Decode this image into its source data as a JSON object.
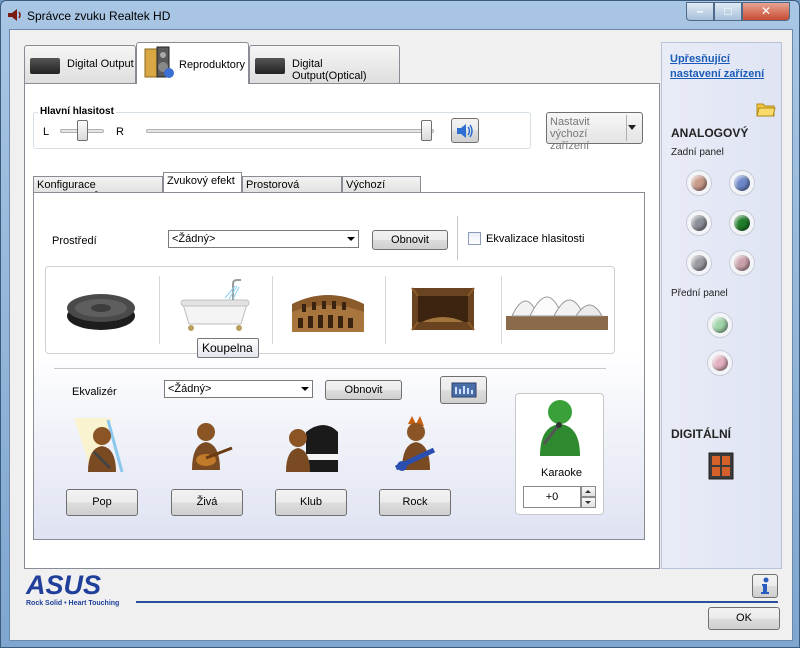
{
  "window": {
    "title": "Správce zvuku Realtek HD",
    "controls": {
      "minimize": "–",
      "maximize": "□",
      "close": "✕"
    }
  },
  "main_tabs": [
    {
      "label": "Digital Output",
      "active": false
    },
    {
      "label": "Reproduktory",
      "active": true
    },
    {
      "label": "Digital Output(Optical)",
      "active": false
    }
  ],
  "volume": {
    "group_label": "Hlavní hlasitost",
    "left_label": "L",
    "right_label": "R",
    "balance_level": 0.5,
    "volume_level": 1.0,
    "default_device_button": "Nastavit výchozí zařízení"
  },
  "sub_tabs": [
    {
      "label": "Konfigurace reproduktorů",
      "active": false
    },
    {
      "label": "Zvukový efekt",
      "active": true
    },
    {
      "label": "Prostorová korekce",
      "active": false
    },
    {
      "label": "Výchozí formát",
      "active": false
    }
  ],
  "environment": {
    "label": "Prostředí",
    "selected": "<Žádný>",
    "reset_button": "Obnovit",
    "loudness_checkbox": "Ekvalizace hlasitosti",
    "loudness_checked": false,
    "tooltip": "Koupelna",
    "items": [
      "stone-disc",
      "bathtub",
      "colosseum",
      "cave",
      "opera-house"
    ]
  },
  "equalizer": {
    "label": "Ekvalizér",
    "selected": "<Žádný>",
    "reset_button": "Obnovit",
    "presets": [
      "Pop",
      "Živá",
      "Klub",
      "Rock"
    ]
  },
  "karaoke": {
    "label": "Karaoke",
    "value": "+0"
  },
  "side_panel": {
    "advanced_link": "Upřesňující nastavení zařízení",
    "analog_heading": "ANALOGOVÝ",
    "back_panel_label": "Zadní panel",
    "front_panel_label": "Přední panel",
    "digital_heading": "DIGITÁLNÍ",
    "colors": {
      "back_jacks": [
        "#c79a8a",
        "#6d87c8",
        "#8a8e96",
        "#1e7c2a",
        "#9a9aa0",
        "#c9a0aa"
      ],
      "front_jacks": [
        "#9fd3a8",
        "#e2b0bf"
      ],
      "digital_port": "#d4602a"
    }
  },
  "footer": {
    "brand": "ASUS",
    "tagline": "Rock Solid • Heart Touching",
    "ok_button": "OK",
    "info_icon": "info-icon"
  },
  "accent": "#2a4f9f"
}
